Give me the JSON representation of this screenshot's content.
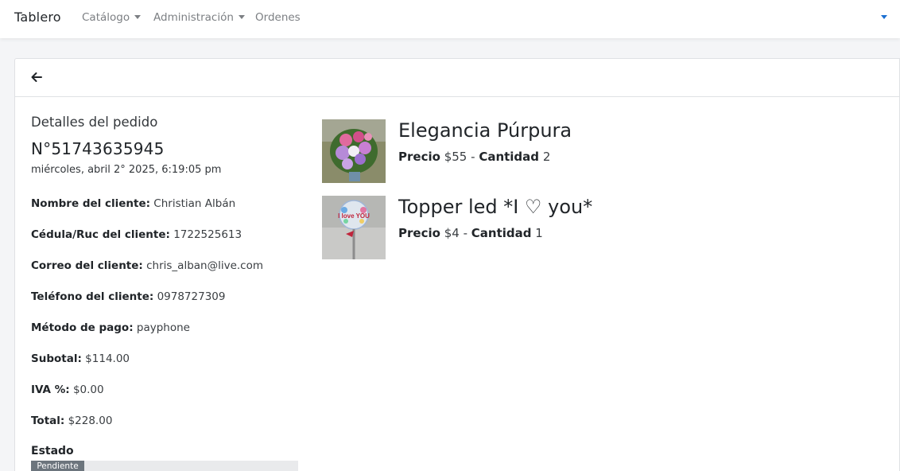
{
  "navbar": {
    "brand": "Tablero",
    "items": [
      {
        "label": "Catálogo",
        "dropdown": true
      },
      {
        "label": "Administración",
        "dropdown": true
      },
      {
        "label": "Ordenes",
        "dropdown": false
      }
    ]
  },
  "order": {
    "section_title": "Detalles del pedido",
    "number": "N°51743635945",
    "date": "miércoles, abril 2° 2025, 6:19:05 pm",
    "fields": [
      {
        "label": "Nombre del cliente:",
        "value": "Christian Albán"
      },
      {
        "label": "Cédula/Ruc del cliente:",
        "value": "1722525613"
      },
      {
        "label": "Correo del cliente:",
        "value": "chris_alban@live.com"
      },
      {
        "label": "Teléfono del cliente:",
        "value": "0978727309"
      },
      {
        "label": "Método de pago:",
        "value": "payphone"
      },
      {
        "label": "Subotal:",
        "value": "$114.00"
      },
      {
        "label": "IVA %:",
        "value": "$0.00"
      },
      {
        "label": "Total:",
        "value": "$228.00"
      }
    ],
    "status_label": "Estado",
    "status_value": "Pendiente"
  },
  "products": [
    {
      "name": "Elegancia Púrpura",
      "price_label": "Precio",
      "price": "$55",
      "qty_label": "Cantidad",
      "qty": "2"
    },
    {
      "name": "Topper led *I ♡ you*",
      "price_label": "Precio",
      "price": "$4",
      "qty_label": "Cantidad",
      "qty": "1"
    }
  ],
  "product_images": [
    {
      "text": ""
    },
    {
      "text": "I love YOU"
    }
  ],
  "colors": {
    "accent": "#1b6fd1",
    "status_badge": "#6c757d"
  }
}
